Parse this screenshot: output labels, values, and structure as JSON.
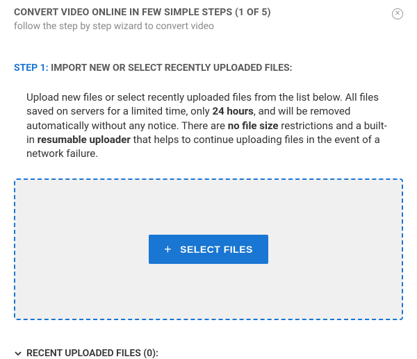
{
  "header": {
    "title": "CONVERT VIDEO ONLINE IN FEW SIMPLE STEPS (1 OF 5)",
    "subtitle": "follow the step by step wizard to convert video",
    "close_label": "✕"
  },
  "step": {
    "label": "STEP 1:",
    "heading": "IMPORT NEW OR SELECT RECENTLY UPLOADED FILES:"
  },
  "description": {
    "part1": "Upload new files or select recently uploaded files from the list below. All files saved on servers for a limited time, only ",
    "bold1": "24 hours",
    "part2": ", and will be removed automatically without any notice. There are ",
    "bold2": "no file size",
    "part3": " restrictions and a built-in ",
    "bold3": "resumable uploader",
    "part4": " that helps to continue uploading files in the event of a network failure."
  },
  "dropzone": {
    "button_label": "SELECT FILES",
    "plus": "+"
  },
  "recent": {
    "label": "RECENT UPLOADED FILES (0):"
  }
}
